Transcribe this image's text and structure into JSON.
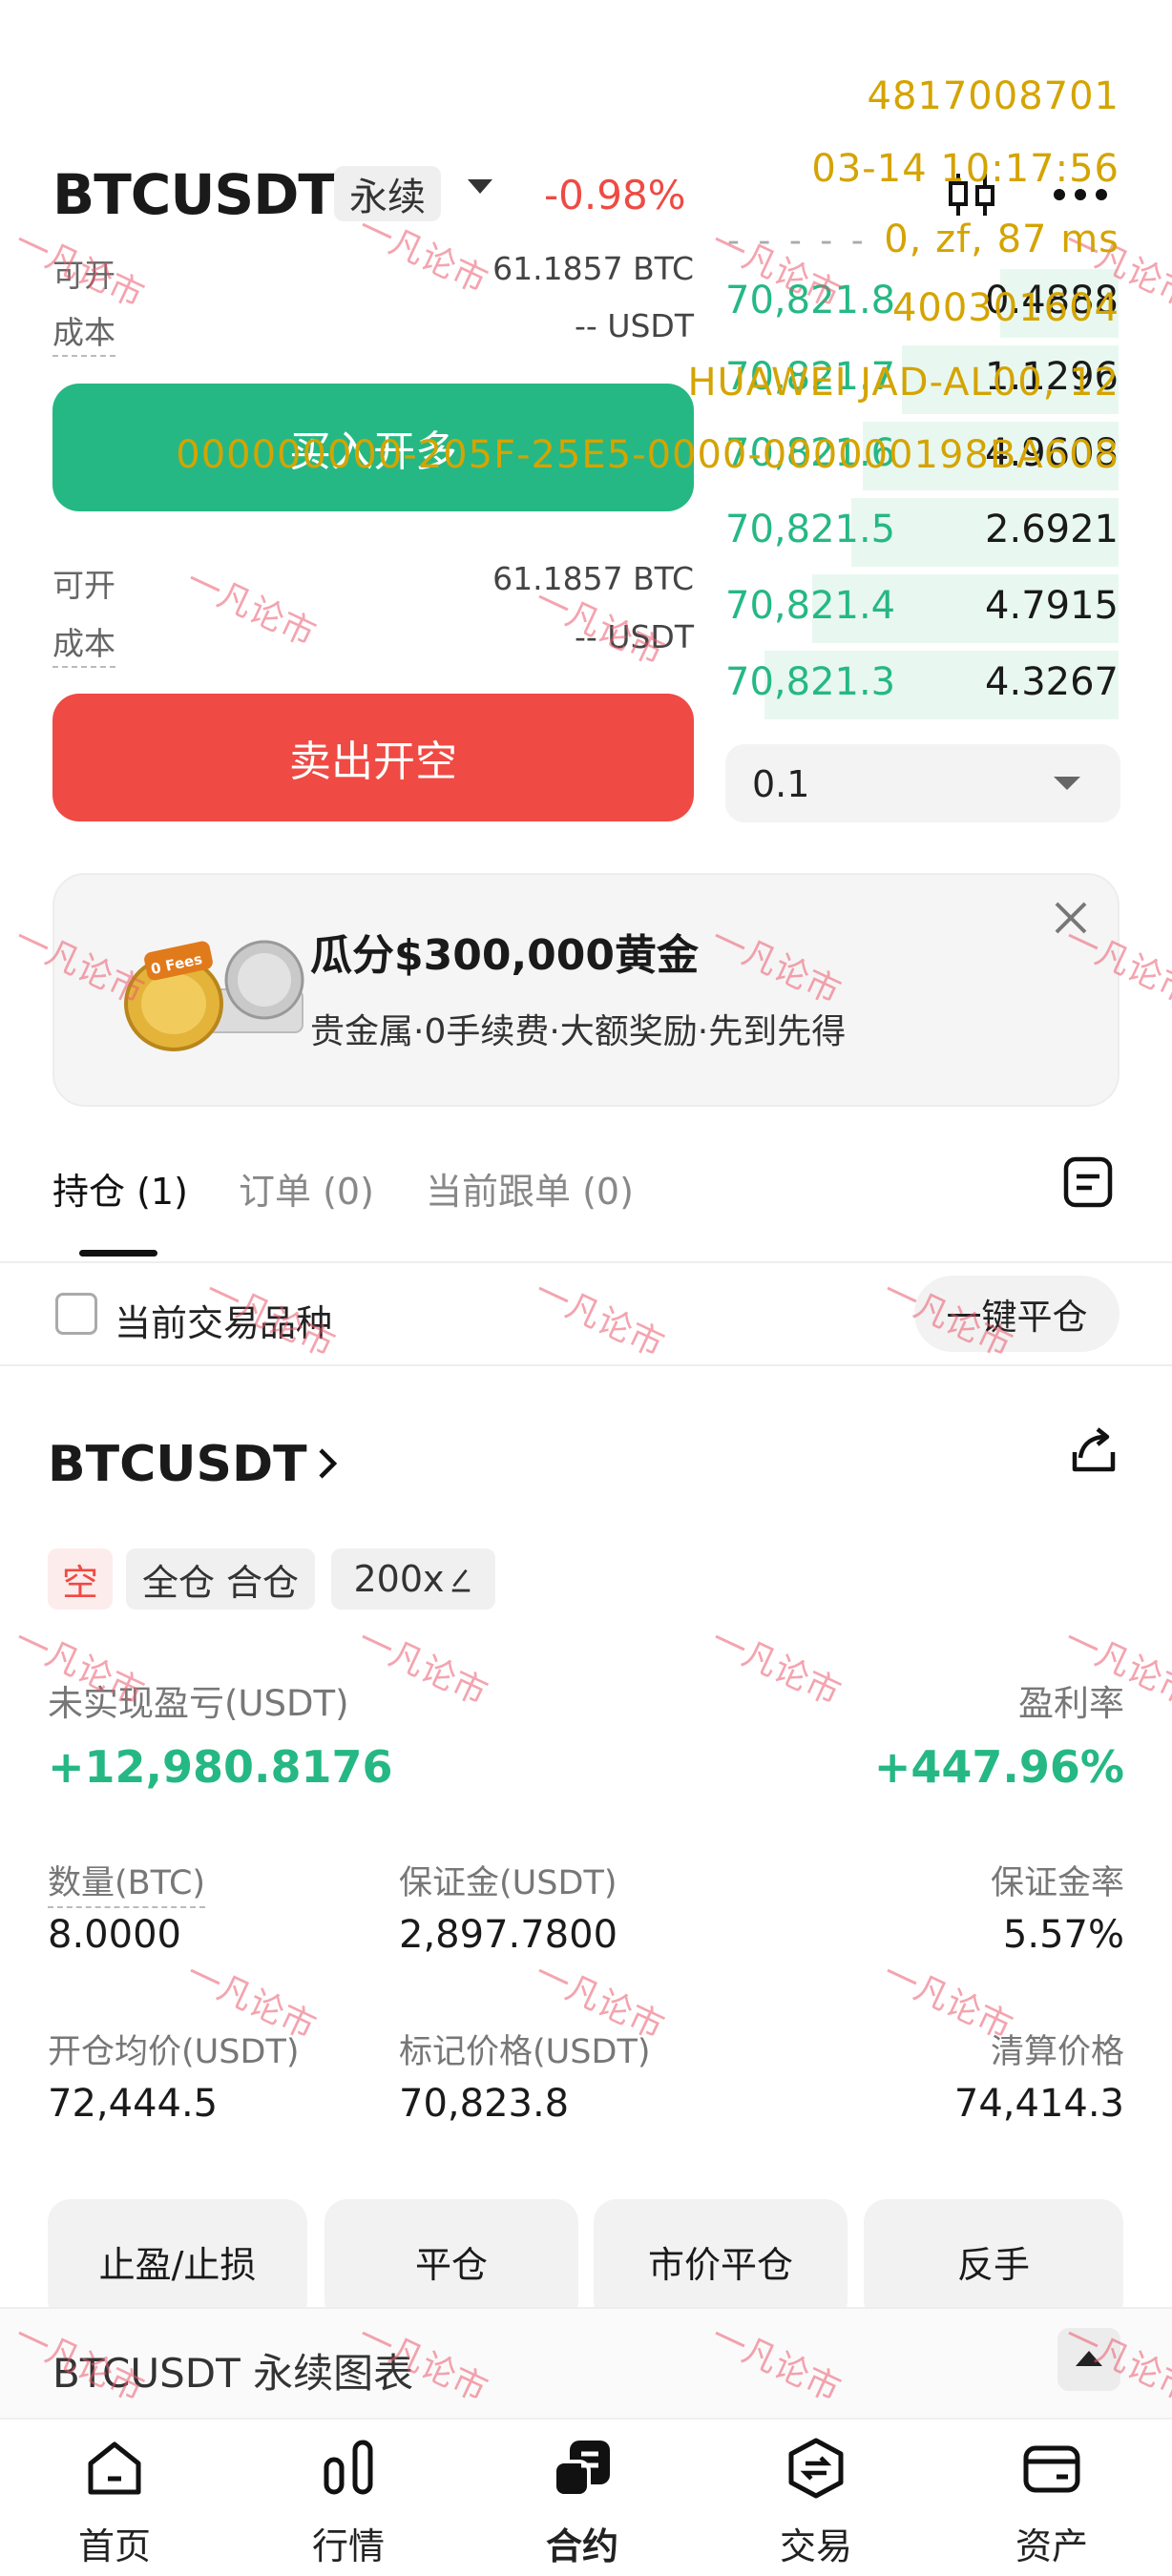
{
  "header": {
    "symbol": "BTCUSDT",
    "contract_type": "永续",
    "change": "-0.98%"
  },
  "trade_panel": {
    "long": {
      "available_label": "可开",
      "available_value": "61.1857 BTC",
      "cost_label": "成本",
      "cost_value": "-- USDT",
      "button_label": "买入开多"
    },
    "short": {
      "available_label": "可开",
      "available_value": "61.1857 BTC",
      "cost_label": "成本",
      "cost_value": "-- USDT",
      "button_label": "卖出开空"
    }
  },
  "order_book": {
    "top_text": "- - - - -",
    "bids": [
      {
        "price": "70,821.8",
        "qty": "0.4888",
        "depth": 0.3
      },
      {
        "price": "70,821.7",
        "qty": "1.1296",
        "depth": 0.55
      },
      {
        "price": "70,821.6",
        "qty": "4.9608",
        "depth": 0.65
      },
      {
        "price": "70,821.5",
        "qty": "2.6921",
        "depth": 0.68
      },
      {
        "price": "70,821.4",
        "qty": "4.7915",
        "depth": 0.78
      },
      {
        "price": "70,821.3",
        "qty": "4.3267",
        "depth": 0.9
      }
    ],
    "depth_step": "0.1"
  },
  "promo": {
    "title": "瓜分$300,000黄金",
    "subtitle": "贵金属·0手续费·大额奖励·先到先得",
    "image_text": "0 Fees"
  },
  "tabs": [
    {
      "label": "持仓 (1)"
    },
    {
      "label": "订单 (0)"
    },
    {
      "label": "当前跟单 (0)"
    }
  ],
  "filter": {
    "label": "当前交易品种",
    "close_all": "一键平仓"
  },
  "position": {
    "symbol": "BTCUSDT",
    "tags": {
      "side": "空",
      "margin_mode": "全仓 合仓",
      "leverage": "200x"
    },
    "pnl_label": "未实现盈亏(USDT)",
    "pnl_value": "+12,980.8176",
    "roe_label": "盈利率",
    "roe_value": "+447.96%",
    "fields": [
      {
        "label": "数量(BTC)",
        "value": "8.0000"
      },
      {
        "label": "保证金(USDT)",
        "value": "2,897.7800"
      },
      {
        "label": "保证金率",
        "value": "5.57%"
      },
      {
        "label": "开仓均价(USDT)",
        "value": "72,444.5"
      },
      {
        "label": "标记价格(USDT)",
        "value": "70,823.8"
      },
      {
        "label": "清算价格",
        "value": "74,414.3"
      }
    ],
    "actions": [
      "止盈/止损",
      "平仓",
      "市价平仓",
      "反手"
    ]
  },
  "chart_bar": {
    "label": "BTCUSDT 永续图表"
  },
  "bottom_nav": [
    {
      "label": "首页",
      "icon": "home-icon"
    },
    {
      "label": "行情",
      "icon": "market-icon"
    },
    {
      "label": "合约",
      "icon": "futures-icon"
    },
    {
      "label": "交易",
      "icon": "trade-icon"
    },
    {
      "label": "资产",
      "icon": "wallet-icon"
    }
  ],
  "overlay_text": [
    "4817008701",
    "03-14 10:17:56",
    "0, zf, 87 ms",
    "400301604",
    "HUAWEI JAD-AL00, 12",
    "000000000-205F-25E5-0000-000000198BA608"
  ],
  "watermark": "一凡论市",
  "colors": {
    "buy": "#25b884",
    "sell": "#ef4a44",
    "watermark": "#eb5a6e",
    "overlay": "#d4a400"
  }
}
